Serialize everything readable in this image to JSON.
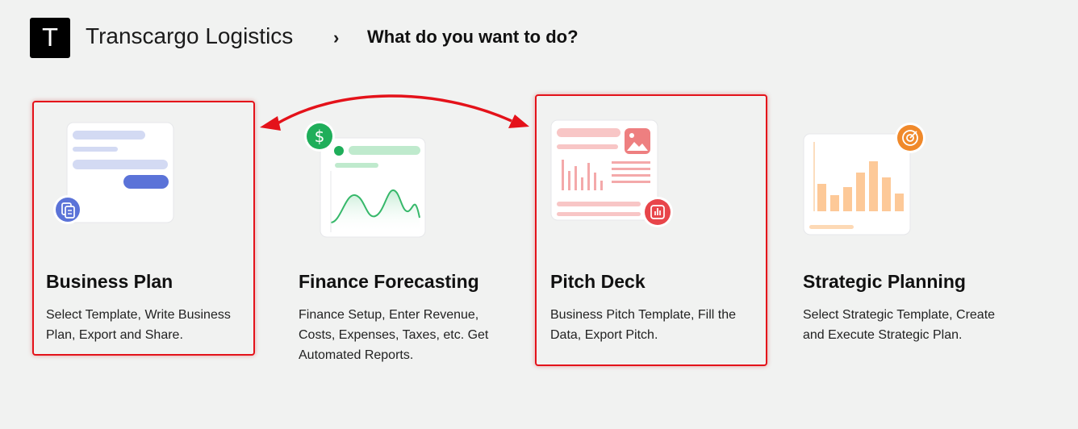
{
  "header": {
    "logo_letter": "T",
    "company": "Transcargo Logistics",
    "separator": "›",
    "title": "What do you want to do?"
  },
  "cards": [
    {
      "title": "Business Plan",
      "description": "Select Template, Write Business Plan, Export and Share.",
      "icon": "document-copy-icon",
      "accent": "#5b73d8"
    },
    {
      "title": "Finance Forecasting",
      "description": "Finance Setup, Enter Revenue, Costs, Expenses, Taxes, etc. Get Automated Reports.",
      "icon": "dollar-icon",
      "accent": "#1fae5a"
    },
    {
      "title": "Pitch Deck",
      "description": "Business Pitch Template, Fill the Data, Export Pitch.",
      "icon": "bar-chart-icon",
      "accent": "#e8454a"
    },
    {
      "title": "Strategic Planning",
      "description": "Select Strategic Template, Create and Execute Strategic Plan.",
      "icon": "target-icon",
      "accent": "#f0892a"
    }
  ],
  "annotation_color": "#e4121a"
}
